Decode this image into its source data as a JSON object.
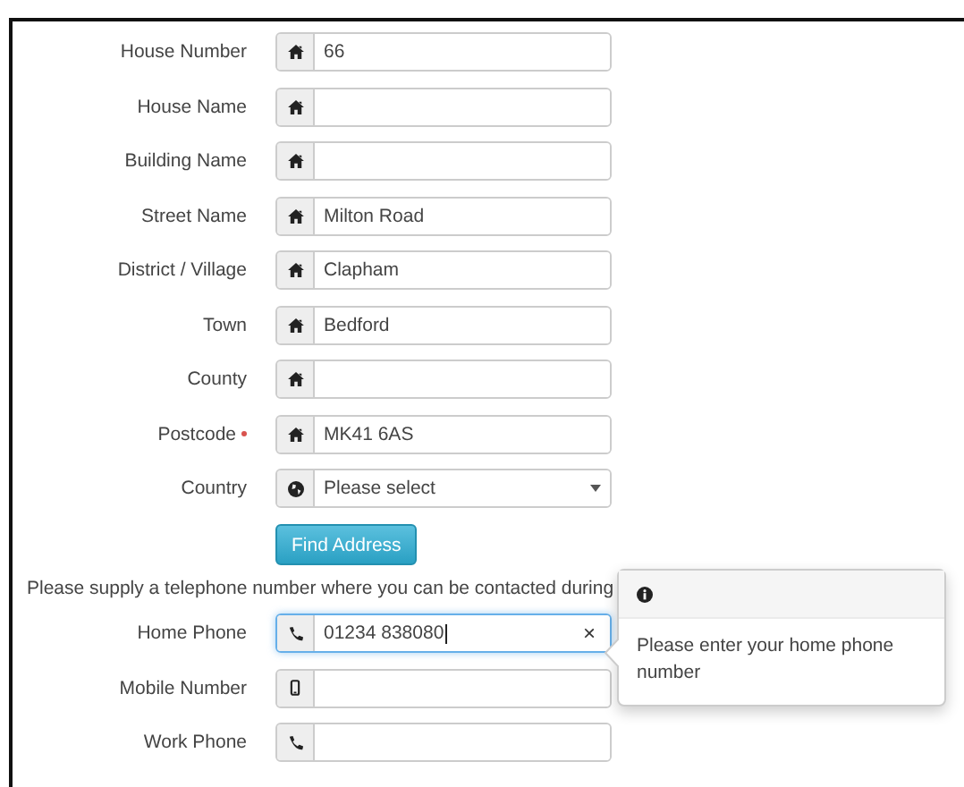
{
  "address_fields": [
    {
      "label": "House Number",
      "kind": "text",
      "value": "66",
      "required": false
    },
    {
      "label": "House Name",
      "kind": "text",
      "required": false
    },
    {
      "label": "Building Name",
      "kind": "text",
      "required": false
    },
    {
      "label": "Street Name",
      "kind": "text",
      "value": "Milton Road",
      "required": false
    },
    {
      "label": "District / Village",
      "kind": "text",
      "value": "Clapham",
      "required": false
    },
    {
      "label": "Town",
      "kind": "text",
      "value": "Bedford",
      "required": false
    },
    {
      "label": "County",
      "kind": "text",
      "required": false
    },
    {
      "label": "Postcode",
      "kind": "text",
      "value": "MK41 6AS",
      "required": true
    },
    {
      "label": "Country",
      "kind": "select",
      "value": "Please select",
      "required": false
    }
  ],
  "find_button": "Find Address",
  "phone_note": "Please supply a telephone number where you can be contacted during",
  "phone_fields": [
    {
      "label": "Home Phone",
      "kind": "phone",
      "value": "01234 838080",
      "focused": true,
      "clear": "×"
    },
    {
      "label": "Mobile Number",
      "kind": "mobile",
      "focused": false
    },
    {
      "label": "Work Phone",
      "kind": "phone",
      "focused": false
    }
  ],
  "popover": {
    "text": "Please enter your home phone number"
  }
}
